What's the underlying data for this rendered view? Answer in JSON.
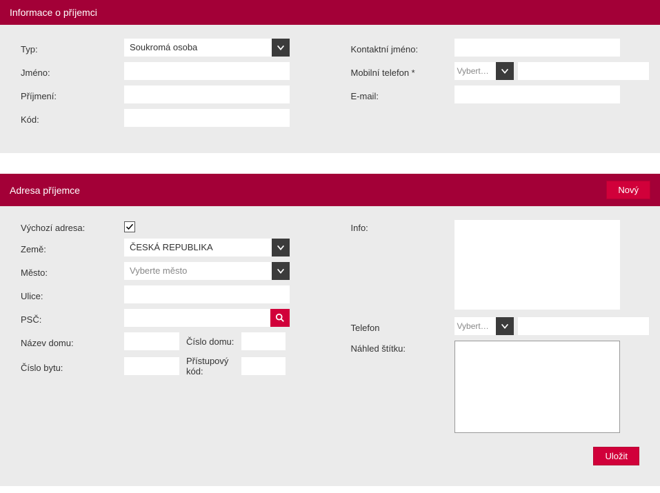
{
  "recipient_info": {
    "header": "Informace o příjemci",
    "type_label": "Typ:",
    "type_value": "Soukromá osoba",
    "name_label": "Jméno:",
    "name_value": "",
    "surname_label": "Příjmení:",
    "surname_value": "",
    "code_label": "Kód:",
    "code_value": "",
    "contact_name_label": "Kontaktní jméno:",
    "contact_name_value": "",
    "mobile_label": "Mobilní telefon *",
    "mobile_prefix_placeholder": "Vyberte kód",
    "mobile_value": "",
    "email_label": "E-mail:",
    "email_value": ""
  },
  "recipient_address": {
    "header": "Adresa příjemce",
    "new_button": "Nový",
    "default_address_label": "Výchozí adresa:",
    "default_address_checked": true,
    "country_label": "Země:",
    "country_value": "ČESKÁ REPUBLIKA",
    "city_label": "Město:",
    "city_placeholder": "Vyberte město",
    "street_label": "Ulice:",
    "street_value": "",
    "postcode_label": "PSČ:",
    "postcode_value": "",
    "house_name_label": "Název domu:",
    "house_name_value": "",
    "house_number_label": "Číslo domu:",
    "house_number_value": "",
    "flat_number_label": "Číslo bytu:",
    "flat_number_value": "",
    "access_code_label": "Přístupový kód:",
    "access_code_value": "",
    "info_label": "Info:",
    "info_value": "",
    "phone_label": "Telefon",
    "phone_prefix_placeholder": "Vyberte kód",
    "phone_value": "",
    "preview_label": "Náhled štítku:",
    "save_button": "Uložit"
  }
}
